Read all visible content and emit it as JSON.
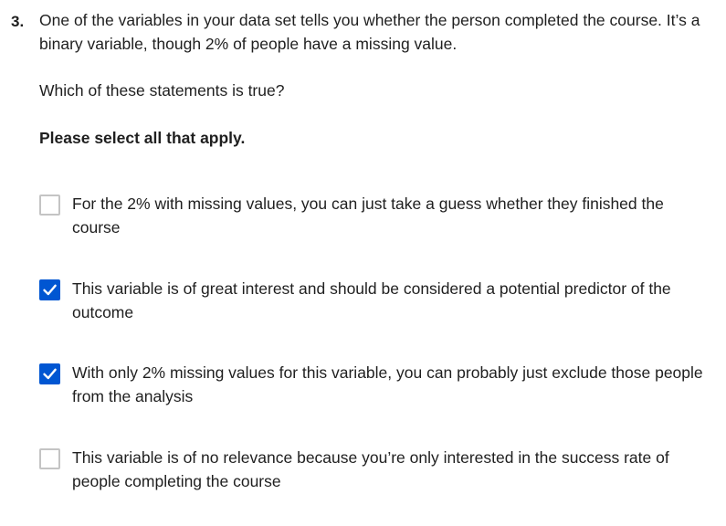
{
  "question": {
    "number": "3.",
    "prompt": "One of the variables in your data set tells you whether the person completed the course. It’s a binary variable, though 2% of people have a missing value.",
    "sub_prompt": "Which of these statements is true?",
    "instruction": "Please select all that apply."
  },
  "options": [
    {
      "label": "For the 2% with missing values, you can just take a guess whether they finished the course",
      "checked": false
    },
    {
      "label": "This variable is of great interest and should be considered a potential predictor of the outcome",
      "checked": true
    },
    {
      "label": "With only 2% missing values for this variable, you can probably just exclude those people from the analysis",
      "checked": true
    },
    {
      "label": "This variable is of no relevance because you’re only interested in the success rate of people completing the course",
      "checked": false
    }
  ],
  "colors": {
    "accent": "#0056d2",
    "checkbox_border": "#c4c4c4",
    "text": "#1f1f1f"
  },
  "icons": {
    "checked": "check-icon"
  }
}
